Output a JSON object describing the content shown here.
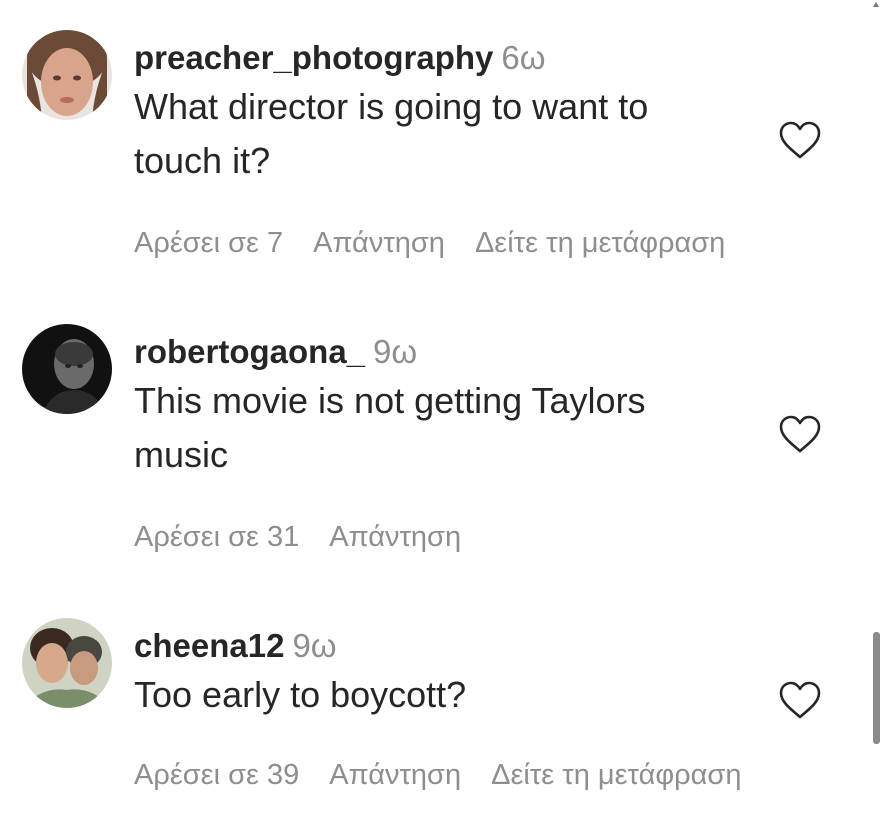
{
  "comments": [
    {
      "username": "preacher_photography",
      "time": "6ω",
      "text": "What director is going to want to touch it?",
      "likes_label": "Αρέσει σε 7",
      "reply_label": "Απάντηση",
      "translate_label": "Δείτε τη μετάφραση",
      "avatar_icon": "woman-portrait-avatar"
    },
    {
      "username": "robertogaona_",
      "time": "9ω",
      "text": "This movie is not getting Taylors music",
      "likes_label": "Αρέσει σε 31",
      "reply_label": "Απάντηση",
      "avatar_icon": "man-dark-portrait-avatar"
    },
    {
      "username": "cheena12",
      "time": "9ω",
      "text": "Too early to boycott?",
      "likes_label": "Αρέσει σε 39",
      "reply_label": "Απάντηση",
      "translate_label": "Δείτε τη μετάφραση",
      "avatar_icon": "two-people-selfie-avatar"
    }
  ],
  "colors": {
    "text": "#262626",
    "secondary": "#8e8e8e",
    "background": "#ffffff"
  },
  "icons": {
    "like": "heart-outline-icon"
  }
}
